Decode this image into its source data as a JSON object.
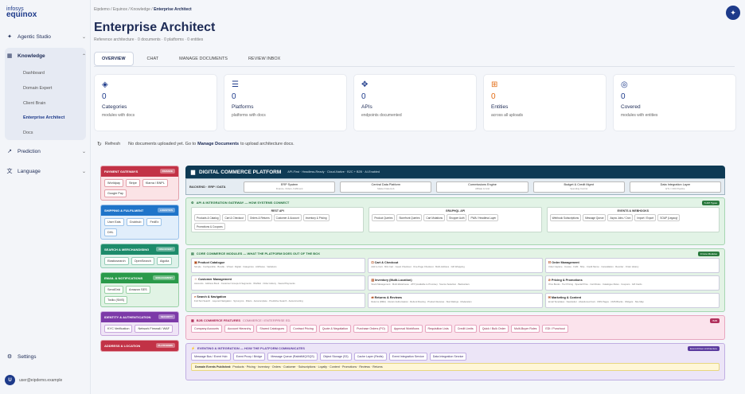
{
  "brand": {
    "line1": "infosys",
    "line2": "equinox"
  },
  "sidebar": {
    "agentic": "Agentic Studio",
    "knowledge": "Knowledge",
    "knowledge_items": [
      "Dashboard",
      "Domain Expert",
      "Client Brain",
      "Enterprise Architect",
      "Docs"
    ],
    "prediction": "Prediction",
    "language": "Language",
    "settings": "Settings",
    "user_email": "user@eipdemo.example",
    "user_initial": "U"
  },
  "breadcrumb": {
    "a": "Eipdemo",
    "b": "Equinox",
    "c": "Knowledge",
    "d": "Enterprise Architect"
  },
  "page": {
    "title": "Enterprise Architect",
    "subtitle": "Reference architecture · 0 documents · 0 platforms · 0 entities"
  },
  "tabs": [
    "OVERVIEW",
    "CHAT",
    "MANAGE DOCUMENTS",
    "REVIEW INBOX"
  ],
  "stats": [
    {
      "num": "0",
      "label": "Categories",
      "desc": "modules with docs",
      "color": "#1d3a8a"
    },
    {
      "num": "0",
      "label": "Platforms",
      "desc": "platforms with docs",
      "color": "#1d3a8a"
    },
    {
      "num": "0",
      "label": "APIs",
      "desc": "endpoints documented",
      "color": "#1d3a8a"
    },
    {
      "num": "0",
      "label": "Entities",
      "desc": "across all uploads",
      "color": "#e26b13"
    },
    {
      "num": "0",
      "label": "Covered",
      "desc": "modules with entities",
      "color": "#1d3a8a"
    }
  ],
  "refresh": {
    "label": "Refresh",
    "msg1": "No documents uploaded yet. Go to",
    "link": "Manage Documents",
    "msg2": "to upload architecture docs."
  },
  "left_sections": [
    {
      "title": "PAYMENT GATEWAYS",
      "tag": "FINANCE",
      "bg": "#c23246",
      "body": "#fbe3e6",
      "border": "#e3a0aa",
      "chips": [
        "Worldpay",
        "Stripe",
        "Klarna / BNPL",
        "Google Pay"
      ]
    },
    {
      "title": "SHIPPING & FULFILMENT",
      "tag": "LOGISTICS",
      "bg": "#1f74c9",
      "body": "#e1eefb",
      "border": "#9cc3ea",
      "chips": [
        "User Eats",
        "Grubhub",
        "FedEx",
        "DHL"
      ]
    },
    {
      "title": "SEARCH & MERCHANDISING",
      "tag": "DISCOVERY",
      "bg": "#1d8b6b",
      "body": "#def2ea",
      "border": "#95ccb8",
      "chips": [
        "Elasticsearch",
        "OpenSearch",
        "Algolia"
      ]
    },
    {
      "title": "EMAIL & NOTIFICATIONS",
      "tag": "ENGAGEMENT",
      "bg": "#2a9a4a",
      "body": "#e1f3e5",
      "border": "#99d0a6",
      "chips": [
        "SendGrid",
        "Amazon SES",
        "Twilio (SMS)"
      ]
    },
    {
      "title": "IDENTITY & AUTHENTICATION",
      "tag": "SECURITY",
      "bg": "#7c3aa8",
      "body": "#efe4f6",
      "border": "#c8a8dd",
      "chips": [
        "KYC Verification",
        "Network Firewall / WAF"
      ]
    },
    {
      "title": "ADDRESS & LOCATION",
      "tag": "PLATFORMS",
      "bg": "#c23246",
      "body": "#fbe3e6",
      "border": "#e3a0aa",
      "chips": []
    }
  ],
  "dcp": {
    "title": "DIGITAL COMMERCE PLATFORM",
    "tagline": "API-First · Headless-Ready · Cloud-Native · B2C + B2B · AI-Enabled",
    "backend_label": "BACKEND · ERP / DATA",
    "backend": [
      {
        "t": "ERP System",
        "d": "Finance, Orders, Fulfilment"
      },
      {
        "t": "Central Data Platform",
        "d": "Master Data Hub"
      },
      {
        "t": "Commissions Engine",
        "d": "Affiliate & Grid"
      },
      {
        "t": "Budget & Credit Mgmt",
        "d": "Spending Control"
      },
      {
        "t": "Data Integration Layer",
        "d": "ETL / CDC Pipeline"
      }
    ],
    "gateway": {
      "title": "API & INTEGRATION GATEWAY — HOW SYSTEMS CONNECT",
      "tag": "5 API Types",
      "boxes": [
        {
          "t": "REST API",
          "chips": [
            "Products & Catalog",
            "Cart & Checkout",
            "Orders & Returns",
            "Customer & Account",
            "Inventory & Pricing",
            "Promotions & Coupons"
          ]
        },
        {
          "t": "GRAPHQL API",
          "chips": [
            "Product Queries",
            "Storefront Queries",
            "Cart Mutations",
            "Shopper Auth",
            "PWA / Headless Layer"
          ]
        },
        {
          "t": "EVENTS & WEBHOOKS",
          "chips": [
            "Webhook Subscriptions",
            "Message Queue",
            "Async Jobs / Cron",
            "Import / Export",
            "SOAP (Legacy)"
          ]
        }
      ]
    },
    "core": {
      "title": "CORE COMMERCE MODULES — WHAT THE PLATFORM DOES OUT OF THE BOX",
      "tag": "9 Core Modules",
      "mods": [
        {
          "t": "Product Catalogue",
          "d": "Simple · Configurable · Bundle · Virtual · Digital · Categories · Attributes · Variations"
        },
        {
          "t": "Cart & Checkout",
          "d": "Add to Cart · Mini Cart · Guest Checkout · One-Page Checkout · Multi-Address · Gift Wrapping"
        },
        {
          "t": "Order Management",
          "d": "Order Capture · Invoice · Fulfil · Ship · Credit Memo · Cancellation · Reorder · Order History"
        },
        {
          "t": "Customer Management",
          "d": "Accounts · Address Book · Customer Groups & Segments · Wishlist · Order History · Saved Payments"
        },
        {
          "t": "Inventory (Multi-Location)",
          "d": "Stock Management · Multi-Warehouse · ATP (Available to Promise) · Source Selection · Backorders"
        },
        {
          "t": "Pricing & Promotions",
          "d": "Price Books · Tier Pricing · Special Price · Cart Rules · Catalogue Rules · Coupons · Gift Cards"
        },
        {
          "t": "Search & Navigation",
          "d": "Full-Text Search · Layered Navigation · Synonyms · Filters · Autocomplete · Predictive Search · Autocorrecting"
        },
        {
          "t": "Returns & Reviews",
          "d": "Returns (RMA) · Return Authorisation · Refund Routing · Product Reviews · Star Ratings · Moderation"
        },
        {
          "t": "Marketing & Content",
          "d": "Email Templates · Newsletter · Abandoned Cart · CMS Pages · CMS Blocks · Widgets · Site Map"
        }
      ]
    },
    "b2b": {
      "title": "B2B COMMERCE FEATURES",
      "subtitle": "COMMERCE / ENTERPRISE ED.",
      "tag": "B2B",
      "chips": [
        "Company Accounts",
        "Account Hierarchy",
        "Shared Catalogues",
        "Contract Pricing",
        "Quote & Negotiation",
        "Purchase Orders (PO)",
        "Approval Workflows",
        "Requisition Lists",
        "Credit Limits",
        "Quick / Bulk Order",
        "Multi-Buyer Roles",
        "EDI / Punchout"
      ]
    },
    "events": {
      "title": "EVENTING & INTEGRATION — HOW THE PLATFORM COMMUNICATES",
      "tag": "Event-Driven Architecture",
      "chips": [
        "Message Bus / Event Hub",
        "Event Proxy / Bridge",
        "Message Queue (RabbitMQ/SQS)",
        "Object Storage (S3)",
        "Cache Layer (Redis)",
        "Event Integration Service",
        "Data Integration Service"
      ],
      "domain_label": "Domain Events Published:",
      "domain_text": "Products · Pricing · Inventory · Orders · Customer · Subscriptions · Loyalty · Content · Promotions · Reviews · Returns"
    }
  }
}
